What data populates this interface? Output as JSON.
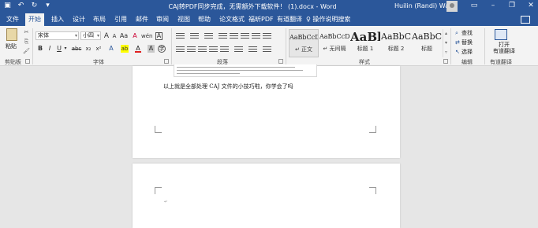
{
  "titlebar": {
    "title": "CAJ转PDF同步完成，无需额外下载软件！ (1).docx  -  Word",
    "user": "Huilin (Randi) Wang",
    "qat_icons": [
      "save-icon",
      "undo-icon",
      "redo-icon",
      "customize-qat-icon"
    ],
    "window_buttons": [
      "ribbon-display-options-icon",
      "minimize-icon",
      "restore-icon",
      "close-icon"
    ]
  },
  "tabs": [
    {
      "label": "文件"
    },
    {
      "label": "开始"
    },
    {
      "label": "插入"
    },
    {
      "label": "设计"
    },
    {
      "label": "布局"
    },
    {
      "label": "引用"
    },
    {
      "label": "邮件"
    },
    {
      "label": "审阅"
    },
    {
      "label": "视图"
    },
    {
      "label": "帮助"
    },
    {
      "label": "论文格式"
    },
    {
      "label": "福昕PDF"
    },
    {
      "label": "有道翻译"
    }
  ],
  "tell_me": "操作说明搜索",
  "ribbon": {
    "clipboard": {
      "paste": "粘贴",
      "label": "剪贴板"
    },
    "font": {
      "font_name": "宋体",
      "font_size": "小四",
      "grow": "A",
      "shrink": "A",
      "change_case": "Aa",
      "clear_format": "A",
      "phonetic": "wén",
      "char_border": "A",
      "bold": "B",
      "italic": "I",
      "underline": "U",
      "strike": "abc",
      "subscript": "x₂",
      "superscript": "x²",
      "text_effect": "A",
      "highlight": "ab",
      "font_color": "A",
      "char_shading": "A",
      "enclose": "字",
      "label": "字体"
    },
    "paragraph": {
      "label": "段落"
    },
    "styles": {
      "items": [
        {
          "sample": "AaBbCcDc",
          "name": "↵ 正文"
        },
        {
          "sample": "AaBbCcDc",
          "name": "↵ 无间隔"
        },
        {
          "sample": "AaBl",
          "name": "标题 1"
        },
        {
          "sample": "AaBbC",
          "name": "标题 2"
        },
        {
          "sample": "AaBbC",
          "name": "标题"
        }
      ],
      "label": "样式"
    },
    "editing": {
      "find": "查找",
      "replace": "替换",
      "select": "选择",
      "label": "编辑"
    },
    "youdao": {
      "open_line1": "打开",
      "open_line2": "有道翻译",
      "label": "有道翻译"
    }
  },
  "document": {
    "line1": "以上就是全部处理 CAJ 文件的小技巧啦，你学会了吗",
    "paragraph_mark": "↵"
  },
  "colors": {
    "accent": "#2b579a",
    "ribbon_bg": "#f3f3f3",
    "canvas_bg": "#e6e6e6",
    "highlight_yellow": "#ffff00",
    "font_red": "#e02020"
  }
}
